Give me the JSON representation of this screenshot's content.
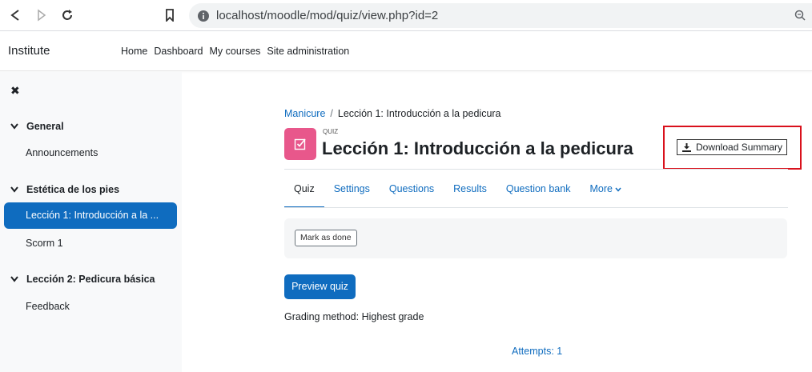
{
  "browser": {
    "url": "localhost/moodle/mod/quiz/view.php?id=2"
  },
  "navbar": {
    "brand": "Institute",
    "links": [
      "Home",
      "Dashboard",
      "My courses",
      "Site administration"
    ]
  },
  "drawer": {
    "sections": [
      {
        "title": "General",
        "items": [
          "Announcements"
        ]
      },
      {
        "title": "Estética de los pies",
        "items": [
          "Lección 1: Introducción a la ...",
          "Scorm 1"
        ]
      },
      {
        "title": "Lección 2: Pedicura básica",
        "items": [
          "Feedback"
        ]
      }
    ]
  },
  "breadcrumb": {
    "course": "Manicure",
    "separator": "/",
    "current": "Lección 1: Introducción a la pedicura"
  },
  "header": {
    "kicker": "QUIZ",
    "title": "Lección 1: Introducción a la pedicura",
    "download_label": "Download Summary",
    "icon_color": "#e8578b"
  },
  "tabs": [
    "Quiz",
    "Settings",
    "Questions",
    "Results",
    "Question bank",
    "More"
  ],
  "completion": {
    "mark_done_label": "Mark as done"
  },
  "main": {
    "preview_label": "Preview quiz",
    "grading_method": "Grading method: Highest grade",
    "attempts": "Attempts: 1"
  },
  "colors": {
    "primary": "#0f6cbf",
    "highlight": "#d9111c"
  }
}
